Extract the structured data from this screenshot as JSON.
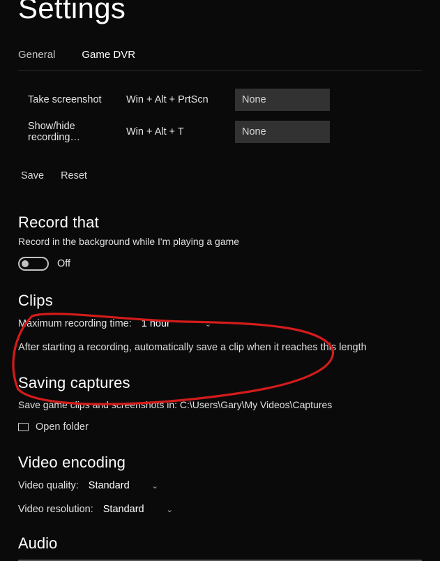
{
  "page": {
    "title": "Settings"
  },
  "tabs": {
    "general": "General",
    "gamedvr": "Game DVR"
  },
  "shortcuts": {
    "row1": {
      "label": "Take screenshot",
      "key": "Win + Alt + PrtScn",
      "box": "None"
    },
    "row2": {
      "label": "Show/hide recording…",
      "key": "Win + Alt + T",
      "box": "None"
    }
  },
  "buttons": {
    "save": "Save",
    "reset": "Reset"
  },
  "record": {
    "heading": "Record that",
    "desc": "Record in the background while I'm playing a game",
    "state": "Off"
  },
  "clips": {
    "heading": "Clips",
    "max_label": "Maximum recording time:",
    "max_value": "1 hour",
    "note": "After starting a recording, automatically save a clip when it reaches this length"
  },
  "captures": {
    "heading": "Saving captures",
    "desc": "Save game clips and screenshots in: C:\\Users\\Gary\\My Videos\\Captures",
    "open": "Open folder"
  },
  "video": {
    "heading": "Video encoding",
    "quality_label": "Video quality:",
    "quality_value": "Standard",
    "res_label": "Video resolution:",
    "res_value": "Standard"
  },
  "audio": {
    "heading": "Audio"
  }
}
